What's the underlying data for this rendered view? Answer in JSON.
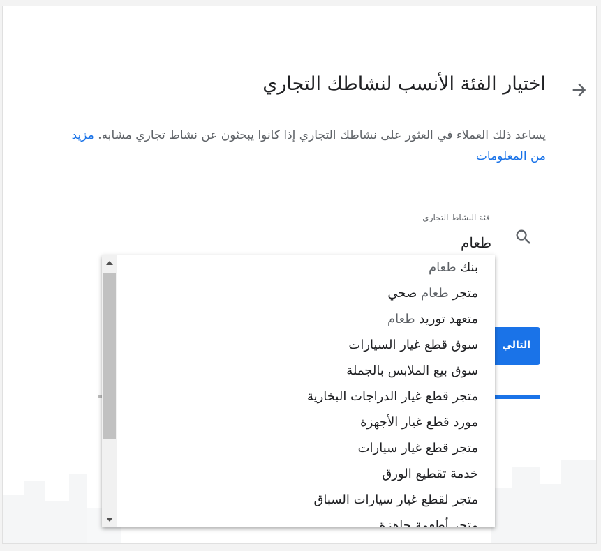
{
  "page": {
    "title": "اختيار الفئة الأنسب لنشاطك التجاري",
    "description": "يساعد ذلك العملاء في العثور على نشاطك التجاري إذا كانوا يبحثون عن نشاط تجاري مشابه.",
    "learn_more": "مزيد من المعلومات"
  },
  "category_field": {
    "label": "فئة النشاط التجاري",
    "value": "طعام"
  },
  "next_button": {
    "label": "التالي"
  },
  "suggestions": [
    {
      "pre": "بنك ",
      "hl": "طعام",
      "post": ""
    },
    {
      "pre": "متجر ",
      "hl": "طعام",
      "post": " صحي"
    },
    {
      "pre": "متعهد توريد ",
      "hl": "طعام",
      "post": ""
    },
    {
      "pre": "سوق قطع غيار السيارات",
      "hl": "",
      "post": ""
    },
    {
      "pre": "سوق بيع الملابس بالجملة",
      "hl": "",
      "post": ""
    },
    {
      "pre": "متجر قطع غيار الدراجات البخارية",
      "hl": "",
      "post": ""
    },
    {
      "pre": "مورد قطع غيار الأجهزة",
      "hl": "",
      "post": ""
    },
    {
      "pre": "متجر قطع غيار سيارات",
      "hl": "",
      "post": ""
    },
    {
      "pre": "خدمة تقطيع الورق",
      "hl": "",
      "post": ""
    },
    {
      "pre": "متجر لقطع غيار سيارات السباق",
      "hl": "",
      "post": ""
    },
    {
      "pre": "متجر أطعمة جاهزة",
      "hl": "",
      "post": ""
    }
  ],
  "colors": {
    "accent": "#1a73e8",
    "text": "#202124",
    "muted": "#5f6368"
  },
  "icons": {
    "back": "arrow-forward-icon",
    "search": "search-icon"
  }
}
